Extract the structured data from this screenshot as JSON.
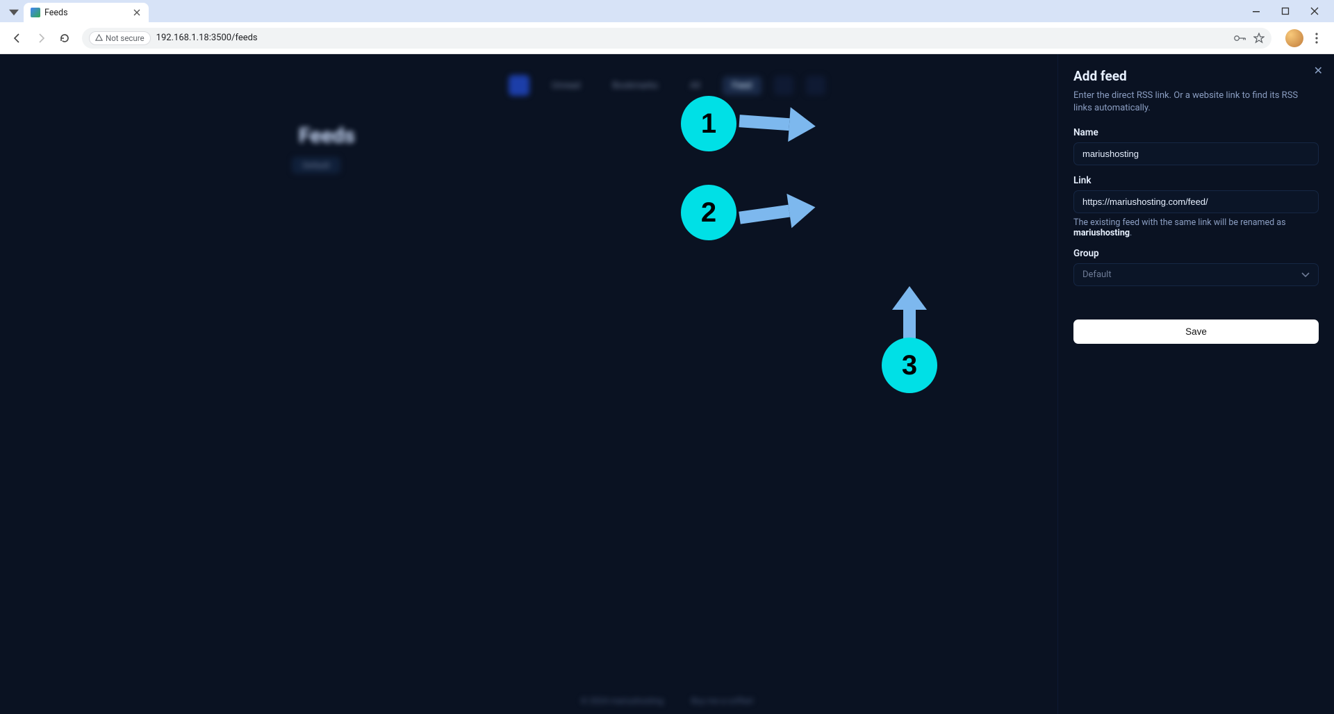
{
  "browser": {
    "tab_title": "Feeds",
    "not_secure_label": "Not secure",
    "url": "192.168.1.18:3500/feeds"
  },
  "app": {
    "page_title": "Feeds",
    "page_chip": "Default",
    "nav": {
      "unread": "Unread",
      "bookmarks": "Bookmarks",
      "all": "All",
      "feed": "Feed"
    },
    "footer_left": "© 2024  mariushosting",
    "footer_right": "Buy me a coffee!"
  },
  "panel": {
    "title": "Add feed",
    "description": "Enter the direct RSS link. Or a website link to find its RSS links automatically.",
    "name_label": "Name",
    "name_value": "mariushosting",
    "link_label": "Link",
    "link_value": "https://mariushosting.com/feed/",
    "rename_hint_prefix": "The existing feed with the same link will be renamed as ",
    "rename_hint_bold": "mariushosting",
    "group_label": "Group",
    "group_value": "Default",
    "save_label": "Save"
  },
  "annotations": {
    "one": "1",
    "two": "2",
    "three": "3"
  }
}
